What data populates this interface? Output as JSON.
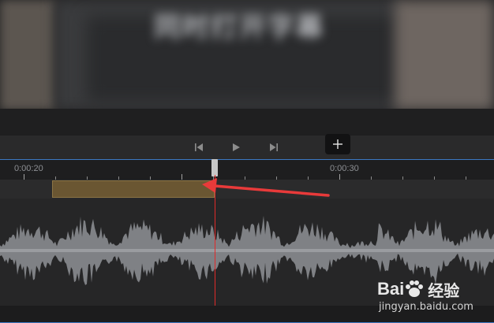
{
  "preview": {
    "caption": "同时打开字幕"
  },
  "controls": {
    "prev_icon": "skip-back-icon",
    "play_icon": "play-icon",
    "next_icon": "skip-forward-icon",
    "add_label": "+"
  },
  "ruler": {
    "labels": [
      "0:00:20",
      "0:00:30"
    ]
  },
  "colors": {
    "clip": "#6a5632",
    "playhead": "#e02a2a",
    "arrow": "#e83a3a",
    "timeline_accent": "#3b78c2"
  },
  "watermark": {
    "logo_text": "Bai",
    "logo_cn": "经验",
    "url": "jingyan.baidu.com"
  }
}
